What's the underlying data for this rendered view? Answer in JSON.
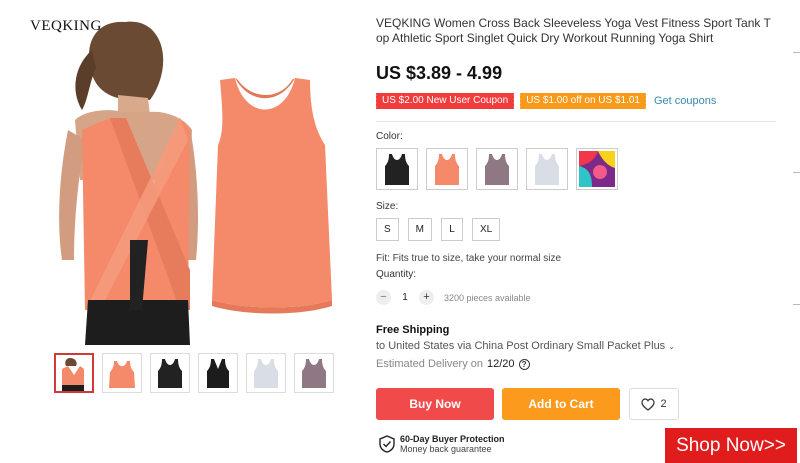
{
  "brand": "VEQKING",
  "product": {
    "title": "VEQKING Women Cross Back Sleeveless Yoga Vest Fitness Sport Tank Top Athletic Sport Singlet Quick Dry Workout Running Yoga Shirt",
    "price": "US $3.89 - 4.99"
  },
  "coupons": {
    "new_user": "US $2.00 New User Coupon",
    "off": "US $1.00 off on US $1.01",
    "get_link": "Get coupons"
  },
  "color": {
    "label": "Color:",
    "options": [
      "black-tank-icon",
      "coral-tank-icon",
      "mauve-tank-icon",
      "white-tank-icon",
      "multicolor-tile-icon"
    ]
  },
  "size": {
    "label": "Size:",
    "options": [
      "S",
      "M",
      "L",
      "XL"
    ]
  },
  "fit_note": "Fit: Fits true to size, take your normal size",
  "quantity": {
    "label": "Quantity:",
    "minus": "−",
    "plus": "+",
    "value": "1",
    "available": "3200 pieces available"
  },
  "shipping": {
    "title": "Free Shipping",
    "line": "to United States via China Post Ordinary Small Packet Plus",
    "delivery_label": "Estimated Delivery on",
    "delivery_date": "12/20"
  },
  "actions": {
    "buy_now": "Buy Now",
    "add_to_cart": "Add to Cart",
    "wish_count": "2"
  },
  "protection": {
    "title": "60-Day Buyer Protection",
    "subtitle": "Money back guarantee"
  },
  "banner": {
    "shop_now": "Shop Now>>"
  },
  "colors": {
    "coral": "#f48a6a",
    "price_red": "#f04a4a",
    "cart_orange": "#fb9a1d",
    "link_teal": "#3a8aa8",
    "shop_red": "#e01c1c"
  }
}
